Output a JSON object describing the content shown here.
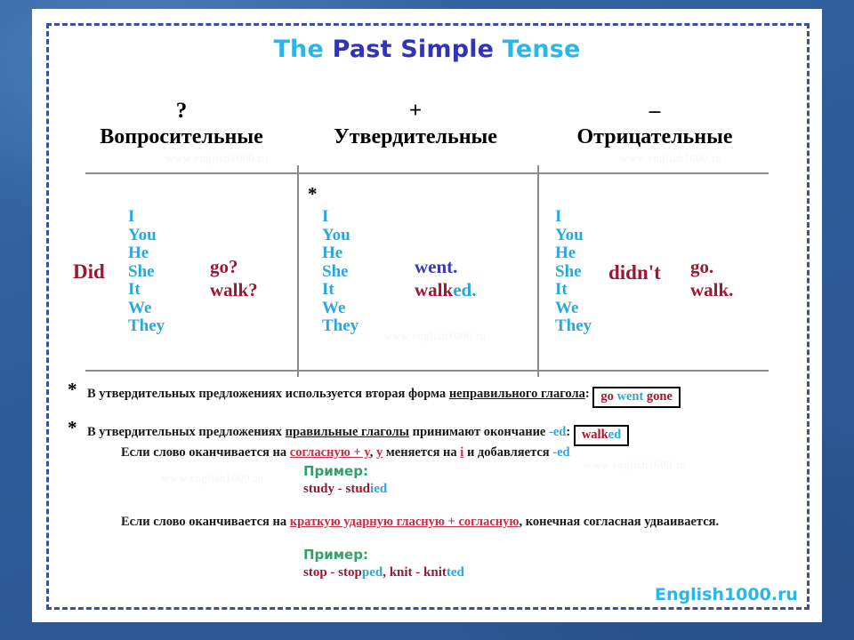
{
  "title": {
    "part1": "The ",
    "part2": "Past Simple ",
    "part3": "Tense"
  },
  "columns": [
    {
      "sign": "?",
      "name": "Вопросительные"
    },
    {
      "sign": "+",
      "name": "Утвердительные"
    },
    {
      "sign": "–",
      "name": "Отрицательные"
    }
  ],
  "pronouns": "I\nYou\nHe\nShe\nIt\nWe\nThey",
  "question_column": {
    "auxiliary": "Did",
    "verb1": "go?",
    "verb2": "walk?"
  },
  "affirmative_column": {
    "asterisk": "*",
    "verb1": "went.",
    "verb2_stem": "walk",
    "verb2_ending": "ed."
  },
  "negative_column": {
    "auxiliary": "didn't",
    "verb1": "go.",
    "verb2": "walk."
  },
  "notes": {
    "note1": {
      "marker": "*",
      "text_before": "В утвердительных предложениях используется вторая форма ",
      "underlined": "неправильного глагола",
      "colon": ":",
      "box": {
        "word1": "go",
        "word2": "went",
        "word3": "gone"
      }
    },
    "note2": {
      "marker": "*",
      "line1_before": "В утвердительных предложениях ",
      "line1_underlined": "правильные глаголы",
      "line1_mid": " принимают окончание ",
      "line1_ed": "-ed",
      "line1_colon": ":",
      "box": {
        "stem": "walk",
        "ending": "ed"
      },
      "line2_before": "Если слово оканчивается на ",
      "line2_red1": "согласную + y",
      "line2_mid1": ", ",
      "line2_red2": "y",
      "line2_mid2": " меняется на ",
      "line2_red3": "i",
      "line2_mid3": " и добавляется ",
      "line2_ed": "-ed"
    },
    "example1": {
      "label": "Пример:",
      "text_stem": "study - stud",
      "text_ending": "ied"
    },
    "note3": {
      "before": "Если слово оканчивается на ",
      "red": "краткую ударную гласную + согласную",
      "after": ", конечная согласная удваивается."
    },
    "example2": {
      "label": "Пример:",
      "stem1": "stop - stop",
      "ending1": "ped",
      "mid": ", knit - knit",
      "ending2": "ted"
    }
  },
  "footer": {
    "logo": "English1000.ru"
  },
  "watermark": "www.english1000.ru",
  "colors": {
    "title_cyan": "#2bb6e8",
    "title_navy": "#3333b5",
    "pronoun_cyan": "#29a8dc",
    "verb_red": "#9c1832",
    "accent_red": "#c03048",
    "example_green": "#33a06b",
    "rule_gray": "#8c8c8c",
    "dashed_border": "#3b4f9c",
    "page_blue": "#2f5f9e"
  }
}
